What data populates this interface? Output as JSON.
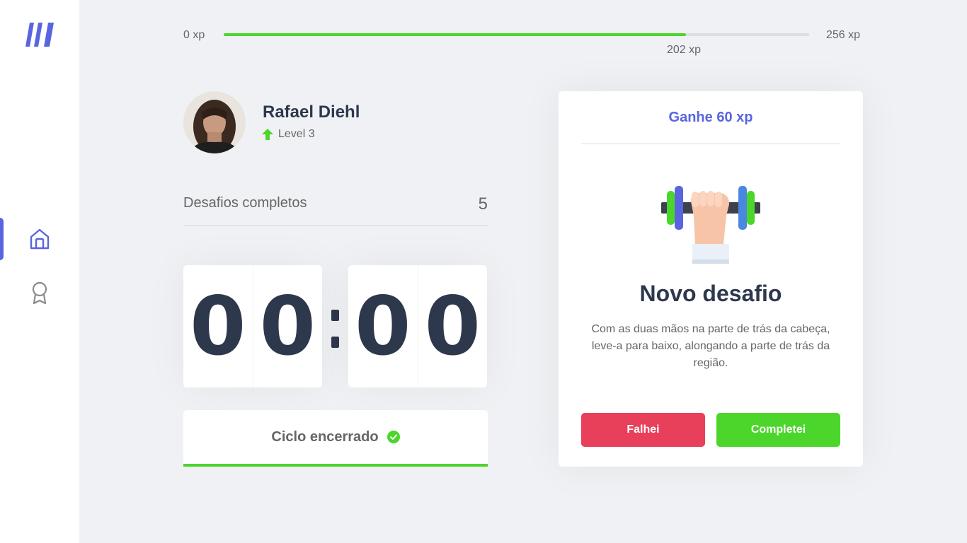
{
  "colors": {
    "background": "#F0F1F4",
    "accent": "#5965E0",
    "success": "#4CD62B",
    "danger": "#E83F5B",
    "title": "#2E384D",
    "text": "#666666"
  },
  "sidebar": {
    "logo_icon": "moveit-logo",
    "items": [
      {
        "name": "home",
        "icon": "home-icon",
        "active": true
      },
      {
        "name": "leaderboard",
        "icon": "award-icon",
        "active": false
      }
    ]
  },
  "experience": {
    "start_label": "0 xp",
    "end_label": "256 xp",
    "current_label": "202 xp",
    "current": 202,
    "max": 256
  },
  "profile": {
    "name": "Rafael Diehl",
    "level_label": "Level 3",
    "level_icon": "arrow-up-icon"
  },
  "completed_challenges": {
    "label": "Desafios completos",
    "count": "5"
  },
  "countdown": {
    "minute_left": "0",
    "minute_right": "0",
    "second_left": "0",
    "second_right": "0"
  },
  "cycle_button": {
    "label": "Ciclo encerrado",
    "icon": "check-circle-icon"
  },
  "challenge": {
    "header": "Ganhe 60 xp",
    "icon": "dumbbell-icon",
    "title": "Novo desafio",
    "description": "Com as duas mãos na parte de trás da cabeça, leve-a para baixo, alongando a parte de trás da região.",
    "fail_label": "Falhei",
    "success_label": "Completei"
  }
}
